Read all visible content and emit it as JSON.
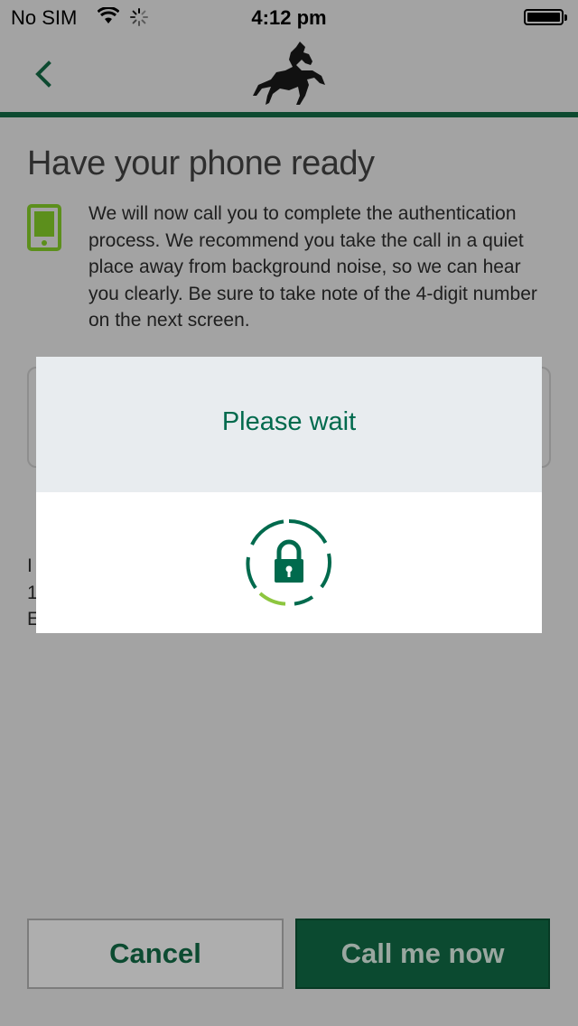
{
  "status_bar": {
    "carrier": "No SIM",
    "time": "4:12 pm",
    "icons": [
      "wifi-icon",
      "activity-spinner-icon",
      "battery-icon"
    ]
  },
  "nav": {
    "back_icon": "chevron-left-icon",
    "logo_icon": "black-horse-logo"
  },
  "page": {
    "title": "Have your phone ready",
    "phone_icon": "phone-icon",
    "description": "We will now call you to complete the authentication process. We recommend you take the call in a quiet place away from background noise, so we can hear you clearly. Be sure to take note of the 4-digit number on the next screen.",
    "info_partial": "I\n1\nE"
  },
  "buttons": {
    "cancel": "Cancel",
    "call": "Call me now"
  },
  "modal": {
    "title": "Please wait",
    "loader_icon": "lock-progress-icon"
  },
  "colors": {
    "brand_green": "#006a4d",
    "dark_green": "#0b4a30",
    "progress_green": "#8dc63f",
    "phone_icon_green": "#5c8f1c",
    "overlay_gray": "#a3a3a3"
  }
}
